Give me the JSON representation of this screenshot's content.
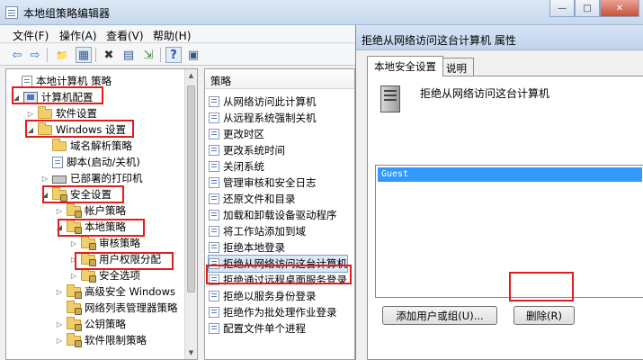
{
  "main": {
    "title": "本地组策略编辑器",
    "controls": {
      "minimize": "—",
      "maximize": "□",
      "close": "✕"
    }
  },
  "menu": [
    "文件(F)",
    "操作(A)",
    "查看(V)",
    "帮助(H)"
  ],
  "toolbar": {
    "icons": [
      "back-arrow-icon",
      "forward-arrow-icon",
      "folder-up-icon",
      "show-hide-tree-icon",
      "delete-icon",
      "properties-icon",
      "export-icon",
      "help-icon",
      "console-tree-icon"
    ],
    "glyphs": {
      "back": "⇦",
      "forward": "⇨",
      "up": "📁",
      "tree": "▦",
      "delete": "✖",
      "properties": "▤",
      "export": "⇲",
      "help": "?",
      "console": "▣"
    }
  },
  "tree": [
    {
      "label": "本地计算机 策略",
      "twisty": "",
      "icon": "doc"
    },
    {
      "label": "计算机配置",
      "twisty": "◢",
      "icon": "computer"
    },
    {
      "label": "软件设置",
      "twisty": "▷",
      "icon": "folder"
    },
    {
      "label": "Windows 设置",
      "twisty": "◢",
      "icon": "folder"
    },
    {
      "label": "域名解析策略",
      "twisty": "",
      "icon": "folder"
    },
    {
      "label": "脚本(启动/关机)",
      "twisty": "",
      "icon": "doc"
    },
    {
      "label": "已部署的打印机",
      "twisty": "▷",
      "icon": "printer"
    },
    {
      "label": "安全设置",
      "twisty": "◢",
      "icon": "lockfolder"
    },
    {
      "label": "帐户策略",
      "twisty": "▷",
      "icon": "lockfolder"
    },
    {
      "label": "本地策略",
      "twisty": "◢",
      "icon": "lockfolder"
    },
    {
      "label": "审核策略",
      "twisty": "▷",
      "icon": "lockfolder"
    },
    {
      "label": "用户权限分配",
      "twisty": "▷",
      "icon": "lockfolder"
    },
    {
      "label": "安全选项",
      "twisty": "▷",
      "icon": "lockfolder"
    },
    {
      "label": "高级安全 Windows",
      "twisty": "▷",
      "icon": "lockfolder"
    },
    {
      "label": "网络列表管理器策略",
      "twisty": "",
      "icon": "lockfolder"
    },
    {
      "label": "公钥策略",
      "twisty": "▷",
      "icon": "lockfolder"
    },
    {
      "label": "软件限制策略",
      "twisty": "▷",
      "icon": "lockfolder"
    }
  ],
  "scroll": {
    "up": "▲",
    "down": "▼"
  },
  "policy_list": {
    "header": "策略",
    "items": [
      "从网络访问此计算机",
      "从远程系统强制关机",
      "更改时区",
      "更改系统时间",
      "关闭系统",
      "管理审核和安全日志",
      "还原文件和目录",
      "加载和卸载设备驱动程序",
      "将工作站添加到域",
      "拒绝本地登录",
      "拒绝从网络访问这台计算机",
      "拒绝通过远程桌面服务登录",
      "拒绝以服务身份登录",
      "拒绝作为批处理作业登录",
      "配置文件单个进程"
    ],
    "selected": "拒绝从网络访问这台计算机"
  },
  "dialog": {
    "title": "拒绝从网络访问这台计算机 属性",
    "tabs": [
      "本地安全设置",
      "说明"
    ],
    "policy_name": "拒绝从网络访问这台计算机",
    "members": [
      "Guest"
    ],
    "add_button": "添加用户或组(U)...",
    "remove_button": "删除(R)"
  }
}
